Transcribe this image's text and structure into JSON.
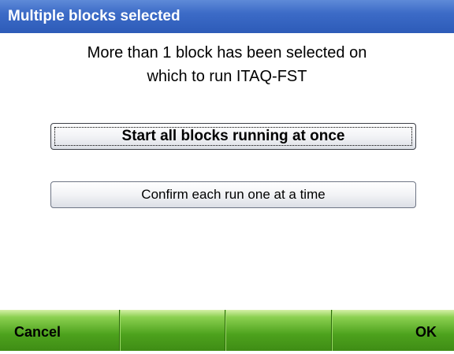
{
  "dialog": {
    "title": "Multiple blocks selected",
    "message_line1": "More than 1 block has been selected on",
    "message_line2": "which to run ITAQ-FST"
  },
  "buttons": {
    "start_all_label": "Start all blocks running at once",
    "confirm_each_label": "Confirm each run one at a time"
  },
  "softkeys": {
    "left_label": "Cancel",
    "center_left_label": "",
    "center_right_label": "",
    "right_label": "OK"
  },
  "colors": {
    "titlebar": "#3c6bc7",
    "softkey_bar": "#4da21d"
  }
}
